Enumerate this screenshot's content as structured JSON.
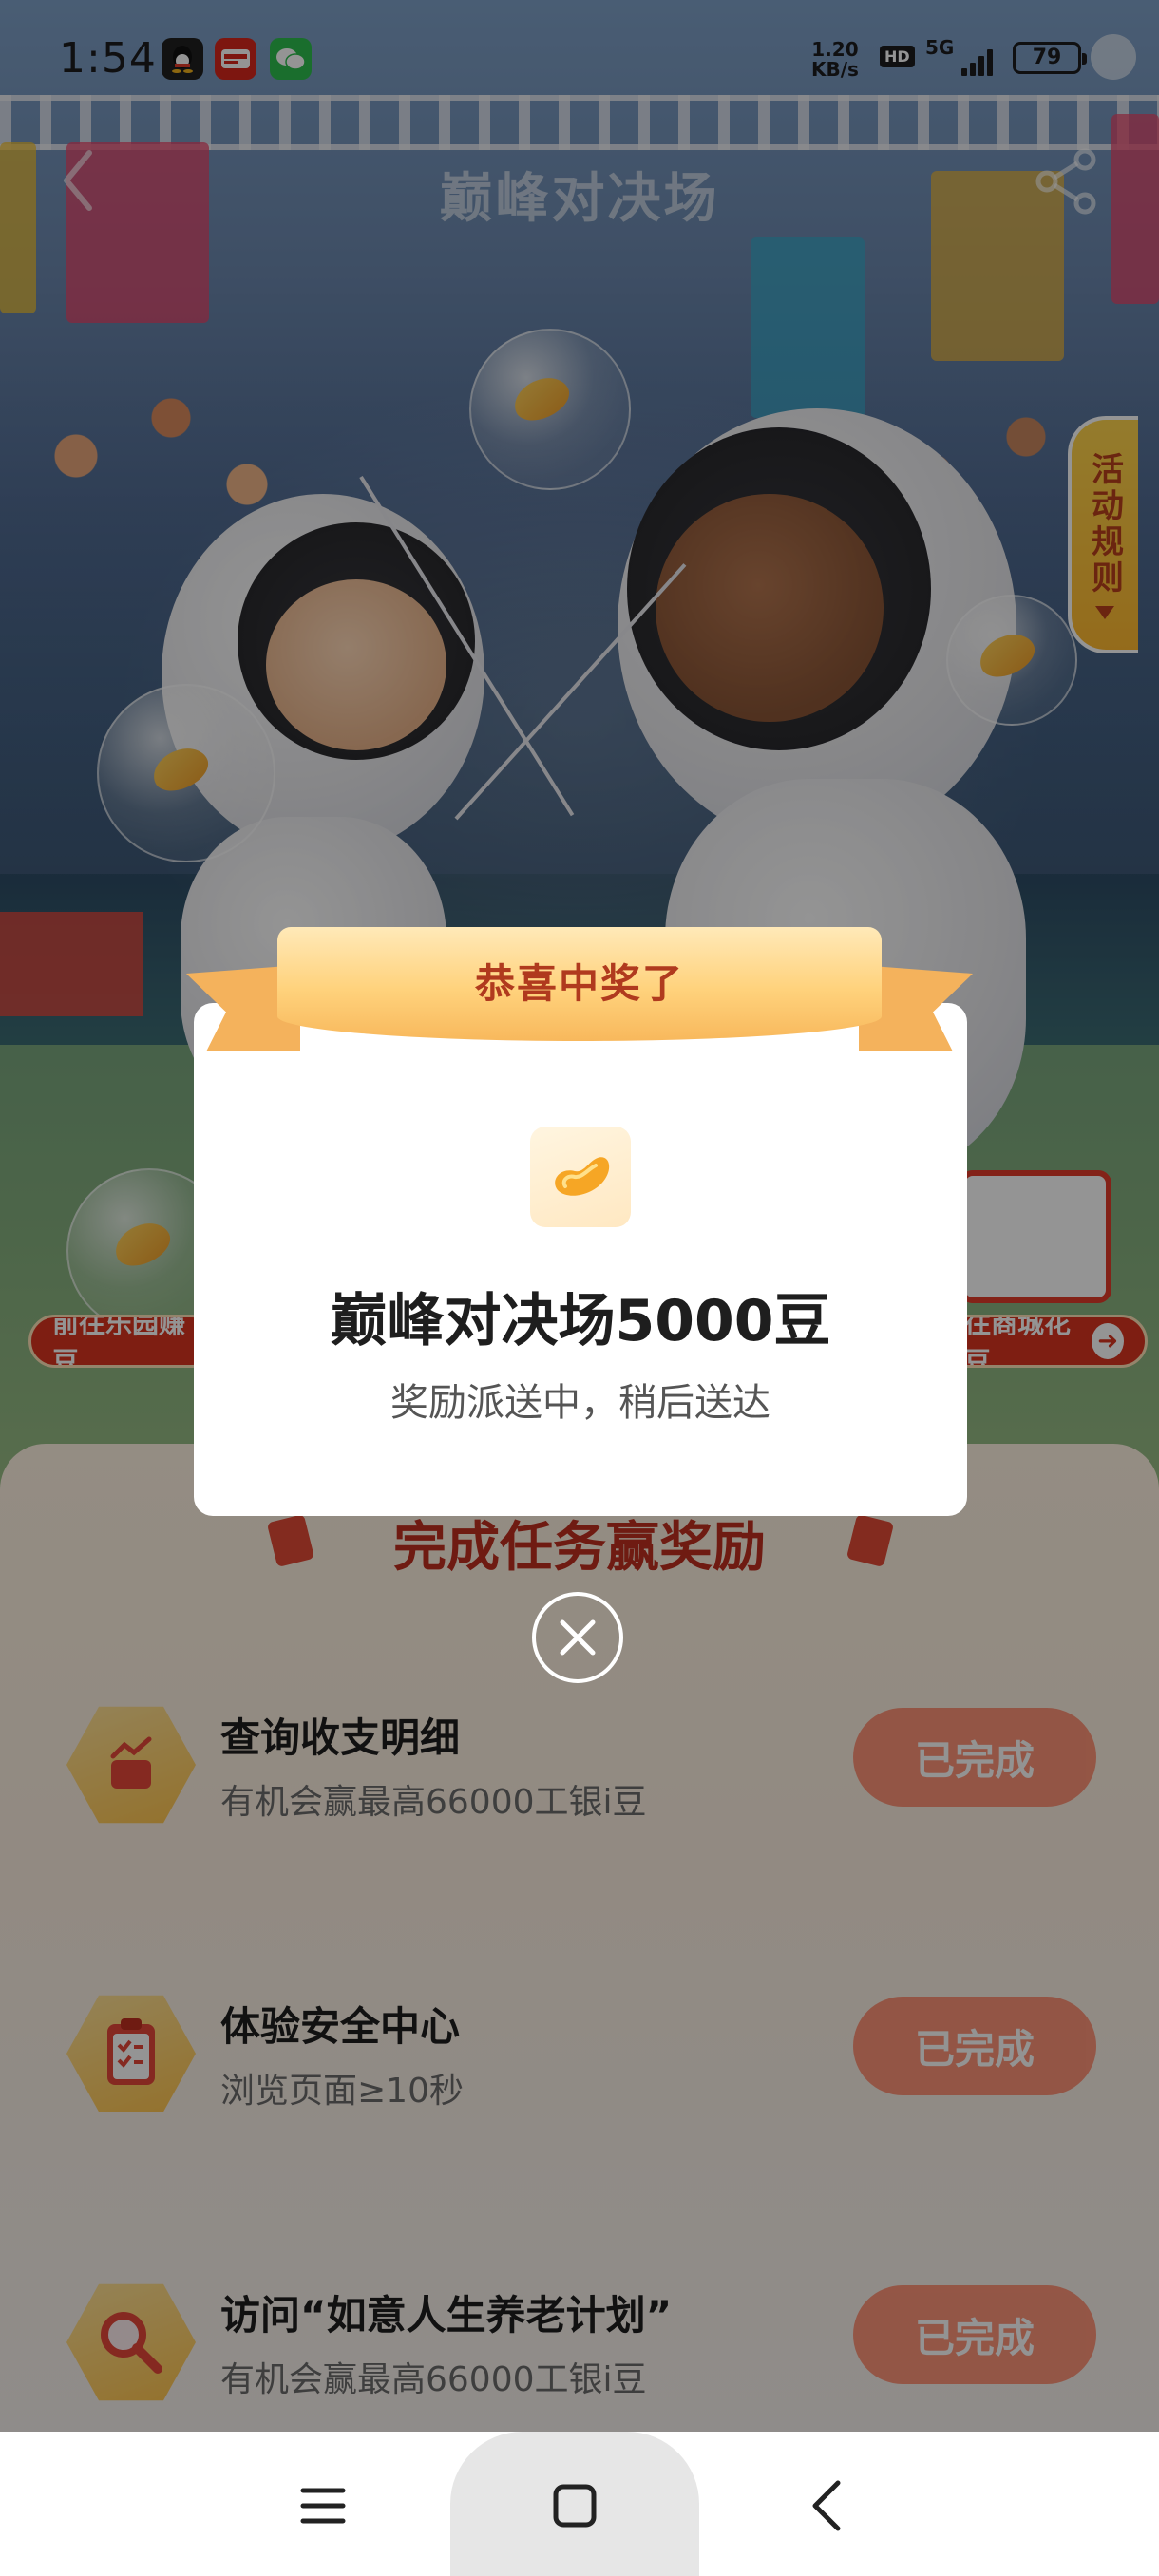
{
  "status_bar": {
    "time": "1:54",
    "apps": [
      {
        "name": "qq-icon",
        "color": "#1f1f1f"
      },
      {
        "name": "icbc-pay-icon",
        "color": "#d8261c"
      },
      {
        "name": "wechat-icon",
        "color": "#2ebd4e"
      }
    ],
    "net_speed_value": "1.20",
    "net_speed_unit": "KB/s",
    "hd": "HD",
    "network": "5G",
    "battery": "79"
  },
  "nav": {
    "title": "巅峰对决场"
  },
  "rules_tab": {
    "label": "活动规则"
  },
  "scene": {
    "left_pill": "前往乐园赚豆",
    "right_pill": "往商城花豆"
  },
  "tasks_panel": {
    "title": "完成任务赢奖励",
    "items": [
      {
        "name": "查询收支明细",
        "desc": "有机会赢最高66000工银i豆",
        "button": "已完成",
        "icon": "receipt-chart-icon"
      },
      {
        "name": "体验安全中心",
        "desc": "浏览页面≥10秒",
        "button": "已完成",
        "icon": "clipboard-check-icon"
      },
      {
        "name": "访问“如意人生养老计划”",
        "desc": "有机会赢最高66000工银i豆",
        "button": "已完成",
        "icon": "magnifier-icon"
      }
    ]
  },
  "modal": {
    "ribbon_text": "恭喜中奖了",
    "prize_title": "巅峰对决场5000豆",
    "prize_subtitle": "奖励派送中，稍后送达"
  },
  "colors": {
    "accent_red": "#c0301f",
    "completed_button": "#ff8a6d",
    "ribbon_gold": "#ffd27c"
  }
}
